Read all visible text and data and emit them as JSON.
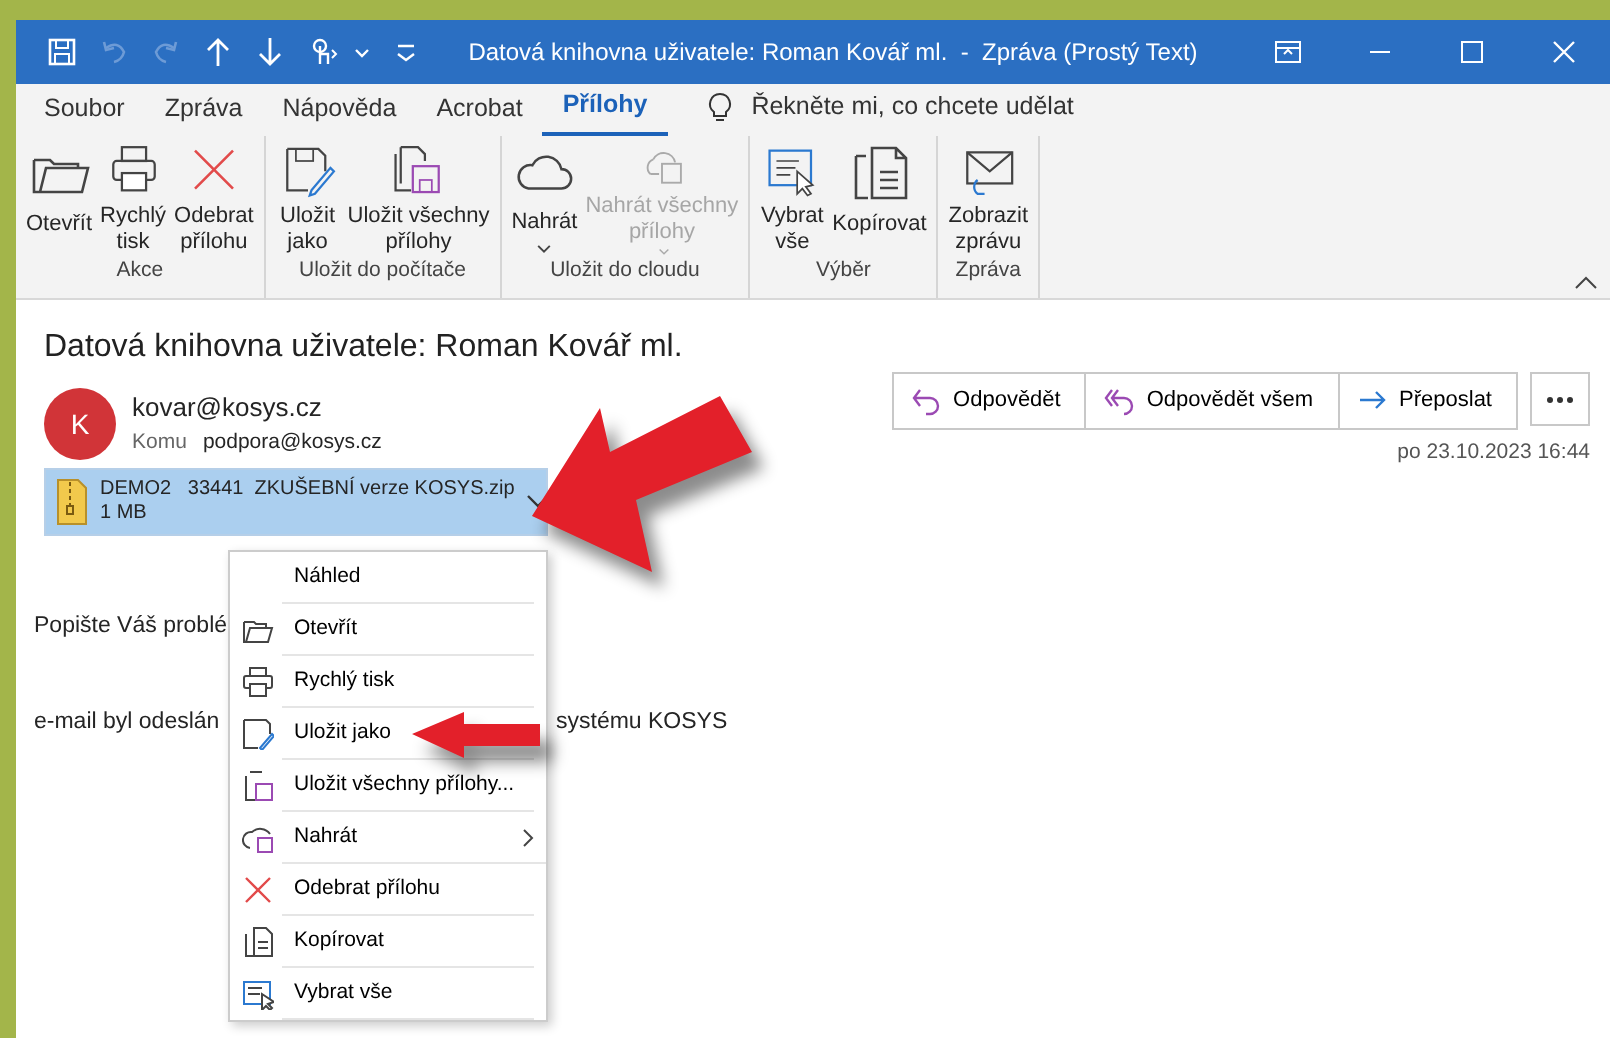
{
  "window": {
    "title": "Datová knihovna uživatele: Roman Kovář ml.  -  Zpráva (Prostý Text)"
  },
  "quick_access": [
    {
      "disabled": false
    },
    {
      "disabled": true
    },
    {
      "disabled": true
    },
    {
      "disabled": false
    },
    {
      "disabled": false
    },
    {
      "disabled": false
    }
  ],
  "tabs": [
    {
      "label": "Soubor",
      "selected": false
    },
    {
      "label": "Zpráva",
      "selected": false
    },
    {
      "label": "Nápověda",
      "selected": false
    },
    {
      "label": "Acrobat",
      "selected": false
    },
    {
      "label": "Přílohy",
      "selected": true
    }
  ],
  "tell_me": {
    "placeholder": "Řekněte mi, co chcete udělat"
  },
  "ribbon_groups": [
    {
      "label": "Akce",
      "buttons": [
        {
          "label": "Otevřít",
          "disabled": false,
          "dropdown": false
        },
        {
          "label": "Rychlý\ntisk",
          "disabled": false,
          "dropdown": false
        },
        {
          "label": "Odebrat\npřílohu",
          "disabled": false,
          "dropdown": false
        }
      ]
    },
    {
      "label": "Uložit do počítače",
      "buttons": [
        {
          "label": "Uložit\njako",
          "disabled": false,
          "dropdown": false
        },
        {
          "label": "Uložit všechny\npřílohy",
          "disabled": false,
          "dropdown": false
        }
      ]
    },
    {
      "label": "Uložit do cloudu",
      "buttons": [
        {
          "label": "Nahrát",
          "disabled": false,
          "dropdown": true
        },
        {
          "label": "Nahrát všechny\npřílohy",
          "disabled": true,
          "dropdown": true
        }
      ]
    },
    {
      "label": "Výběr",
      "buttons": [
        {
          "label": "Vybrat\nvše",
          "disabled": false,
          "dropdown": false
        },
        {
          "label": "Kopírovat",
          "disabled": false,
          "dropdown": false
        }
      ]
    },
    {
      "label": "Zpráva",
      "buttons": [
        {
          "label": "Zobrazit\nzprávu",
          "disabled": false,
          "dropdown": false
        }
      ]
    }
  ],
  "message": {
    "subject": "Datová knihovna uživatele: Roman Kovář ml.",
    "avatar_initial": "K",
    "sender": "kovar@kosys.cz",
    "to_label": "Komu",
    "to": "podpora@kosys.cz",
    "actions": [
      {
        "label": "Odpovědět"
      },
      {
        "label": "Odpovědět všem"
      },
      {
        "label": "Přeposlat"
      }
    ],
    "date": "po 23.10.2023 16:44",
    "attachment": {
      "name": "DEMO2   33441  ZKUŠEBNÍ verze KOSYS.zip",
      "size": "1 MB",
      "selected": true
    },
    "body": [
      {
        "parts": [
          "Popište Váš problé"
        ]
      },
      {
        "parts": [
          "e-mail byl odeslán",
          "systému KOSYS"
        ]
      }
    ]
  },
  "context_menu": [
    {
      "label": "Náhled",
      "submenu": false
    },
    {
      "label": "Otevřít",
      "submenu": false
    },
    {
      "label": "Rychlý tisk",
      "submenu": false
    },
    {
      "label": "Uložit jako",
      "submenu": false
    },
    {
      "label": "Uložit všechny přílohy...",
      "submenu": false
    },
    {
      "label": "Nahrát",
      "submenu": true
    },
    {
      "label": "Odebrat přílohu",
      "submenu": false
    },
    {
      "label": "Kopírovat",
      "submenu": false
    },
    {
      "label": "Vybrat vše",
      "submenu": false
    }
  ]
}
